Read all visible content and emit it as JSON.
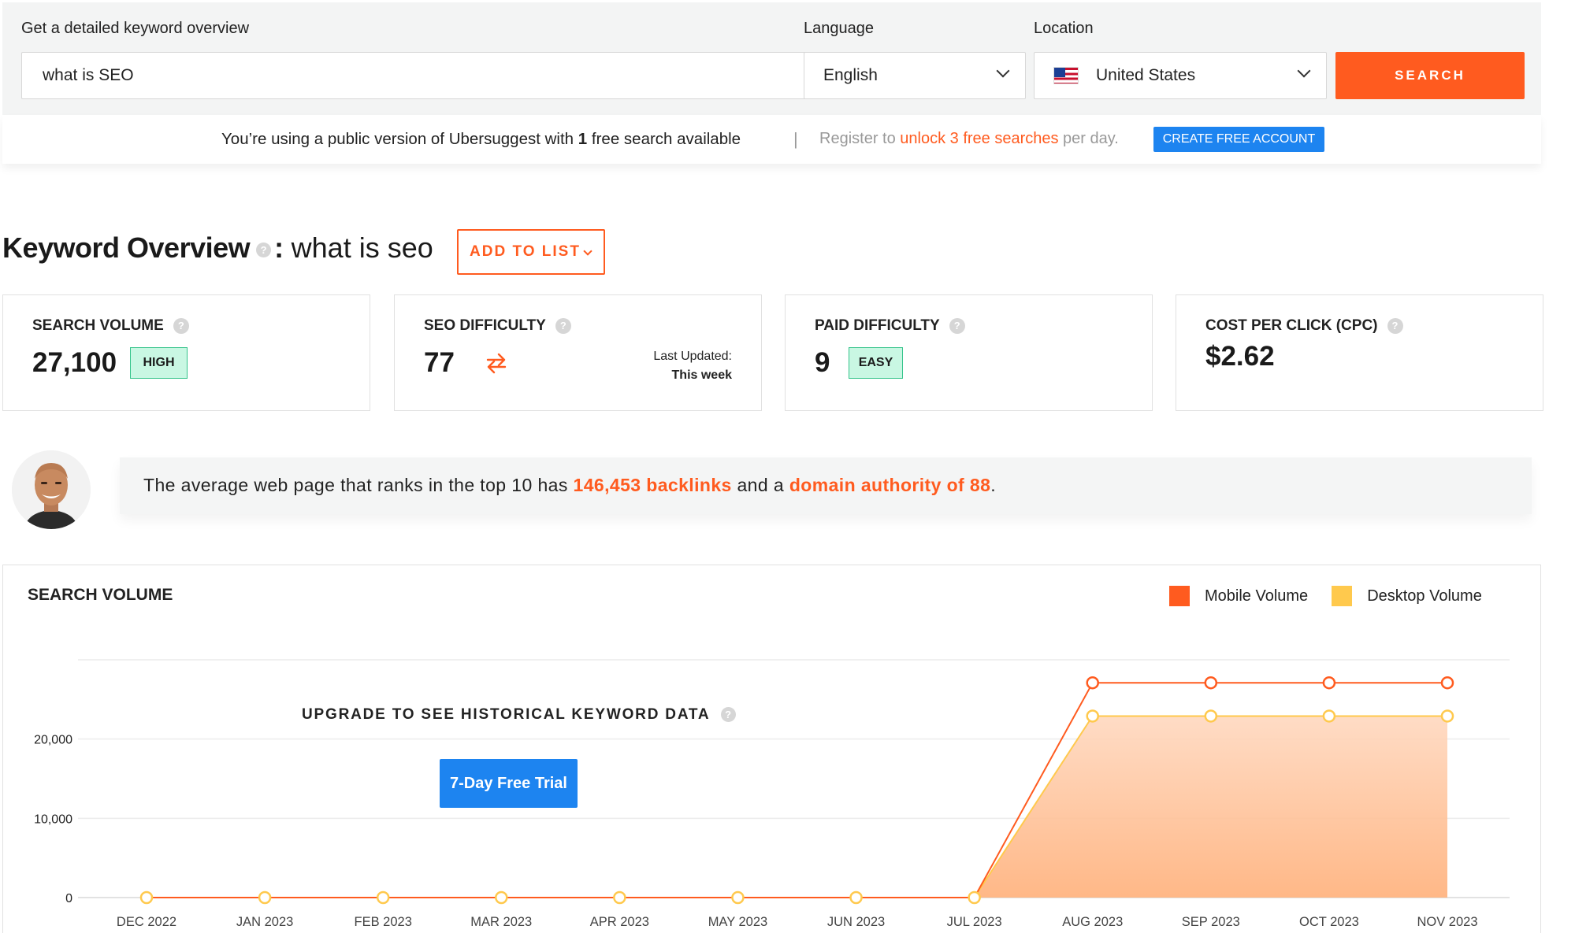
{
  "search": {
    "label": "Get a detailed keyword overview",
    "keyword": "what is SEO",
    "language_label": "Language",
    "language_value": "English",
    "location_label": "Location",
    "location_value": "United States",
    "location_flag_icon": "us-flag-icon",
    "search_button": "SEARCH"
  },
  "notice": {
    "prefix": "You’re using a public version of Ubersuggest with ",
    "count": "1",
    "suffix": " free search available",
    "separator": "|",
    "register_prefix": "Register to ",
    "register_link": "unlock 3 free searches",
    "register_suffix": " per day.",
    "create_button": "CREATE FREE ACCOUNT"
  },
  "overview": {
    "title": "Keyword Overview",
    "separator": ":",
    "keyword": "what is seo",
    "add_to_list": "ADD TO LIST",
    "help_glyph": "?"
  },
  "metrics": {
    "search_volume": {
      "label": "SEARCH VOLUME",
      "value": "27,100",
      "badge": "HIGH"
    },
    "seo_difficulty": {
      "label": "SEO DIFFICULTY",
      "value": "77",
      "updated_label": "Last Updated:",
      "updated_value": "This week"
    },
    "paid_difficulty": {
      "label": "PAID DIFFICULTY",
      "value": "9",
      "badge": "EASY"
    },
    "cpc": {
      "label": "COST PER CLICK (CPC)",
      "value": "$2.62"
    }
  },
  "tip": {
    "prefix": "The average web page that ranks in the top 10 has ",
    "backlinks": "146,453 backlinks",
    "middle": " and a ",
    "domain_authority": "domain authority of 88",
    "suffix": "."
  },
  "volume_chart": {
    "title": "SEARCH VOLUME",
    "upgrade_text": "UPGRADE TO SEE HISTORICAL KEYWORD DATA",
    "trial_button": "7-Day Free Trial"
  },
  "colors": {
    "accent": "#ff5b1f",
    "blue": "#1d84f0",
    "mobile": "#ff5b1f",
    "desktop": "#ffc94d",
    "badge_bg": "#c9f7e3"
  },
  "chart_data": {
    "type": "area",
    "title": "SEARCH VOLUME",
    "categories": [
      "DEC 2022",
      "JAN 2023",
      "FEB 2023",
      "MAR 2023",
      "APR 2023",
      "MAY 2023",
      "JUN 2023",
      "JUL 2023",
      "AUG 2023",
      "SEP 2023",
      "OCT 2023",
      "NOV 2023"
    ],
    "series": [
      {
        "name": "Mobile Volume",
        "color": "#ff5b1f",
        "values": [
          0,
          0,
          0,
          0,
          0,
          0,
          0,
          0,
          27100,
          27100,
          27100,
          27100
        ]
      },
      {
        "name": "Desktop Volume",
        "color": "#ffc94d",
        "values": [
          0,
          0,
          0,
          0,
          0,
          0,
          0,
          0,
          22900,
          22900,
          22900,
          22900
        ]
      }
    ],
    "y_ticks": [
      "0",
      "10,000",
      "20,000"
    ],
    "ylim": [
      0,
      30000
    ],
    "grid": true,
    "legend": "top-right"
  }
}
